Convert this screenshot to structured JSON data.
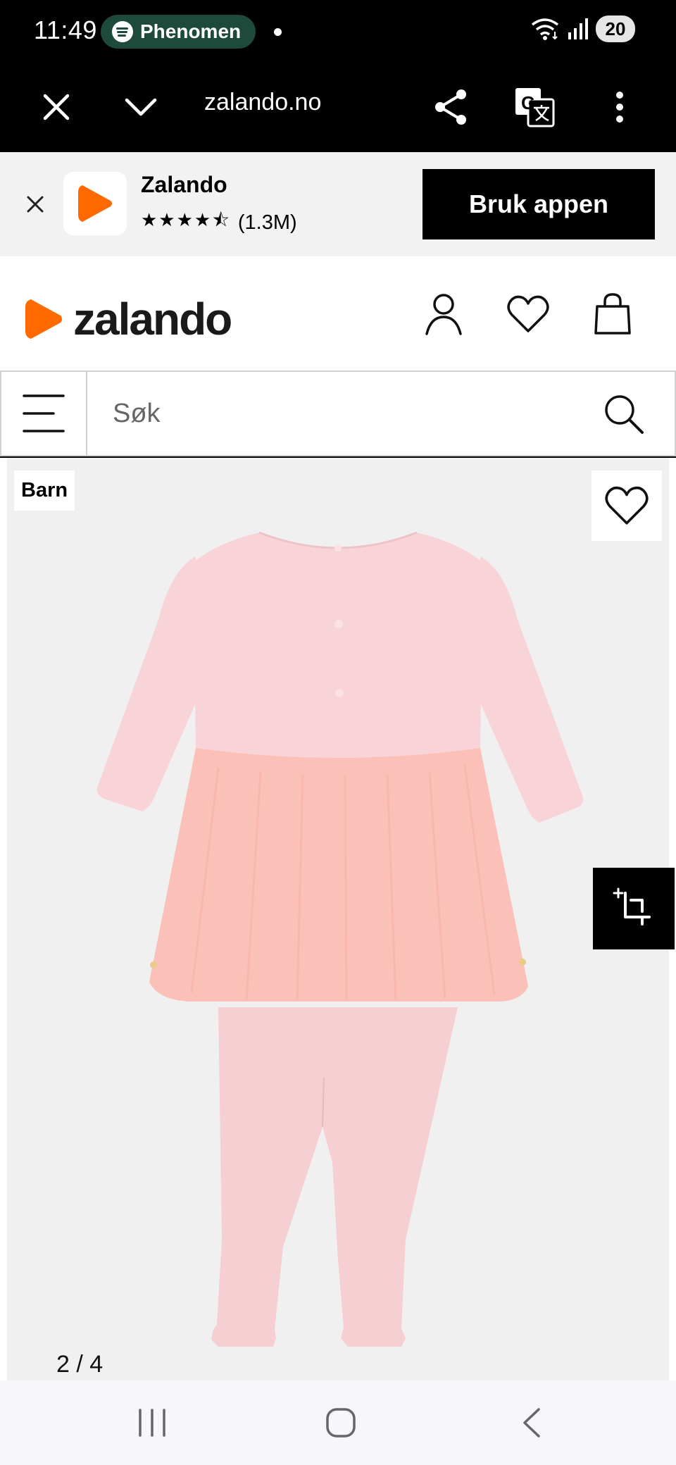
{
  "status_bar": {
    "time": "11:49",
    "media_app": "Phenomen",
    "battery": "20"
  },
  "browser": {
    "url": "zalando.no"
  },
  "app_banner": {
    "app_name": "Zalando",
    "stars": "★★★★⯪",
    "rating_count": "(1.3M)",
    "cta_label": "Bruk appen"
  },
  "header": {
    "logo_text": "zalando",
    "brand_color": "#ff6900"
  },
  "search": {
    "placeholder": "Søk"
  },
  "product": {
    "badge": "Barn",
    "pager": "2 / 4",
    "dress_bodice_color": "#f8d4d8",
    "tulle_color": "#fbc1b8",
    "leggings_color": "#f6cfd3"
  },
  "icons": {
    "close_tab": "close-icon",
    "expand": "chevron-down-icon",
    "share": "share-icon",
    "translate": "translate-icon",
    "more": "more-vertical-icon",
    "account": "user-icon",
    "wishlist": "heart-icon",
    "bag": "bag-icon",
    "menu": "menu-icon",
    "search": "search-icon",
    "crop": "crop-search-icon"
  }
}
